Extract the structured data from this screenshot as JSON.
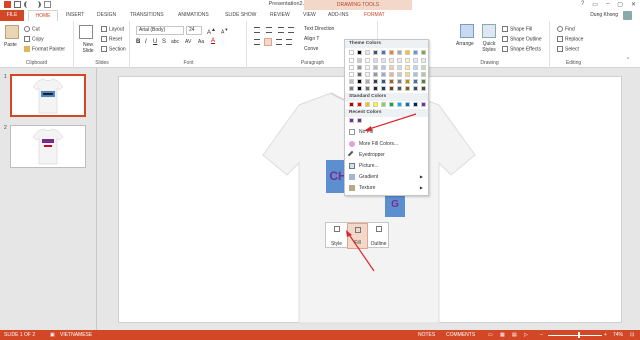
{
  "titlebar": {
    "title": "Presentation2.pptx - Microsoft PowerPoint",
    "contextual_header": "DRAWING TOOLS",
    "window_controls": [
      "?",
      "▭",
      "–",
      "▢",
      "✕"
    ]
  },
  "tabs": [
    "FILE",
    "HOME",
    "INSERT",
    "DESIGN",
    "TRANSITIONS",
    "ANIMATIONS",
    "SLIDE SHOW",
    "REVIEW",
    "VIEW",
    "ADD-INS",
    "FORMAT"
  ],
  "user": {
    "name": "Dung Khong"
  },
  "ribbon": {
    "clipboard": {
      "paste": "Paste",
      "cut": "Cut",
      "copy": "Copy",
      "format_painter": "Format Painter",
      "label": "Clipboard"
    },
    "slides": {
      "new_slide": "New Slide",
      "layout": "Layout",
      "reset": "Reset",
      "section": "Section",
      "label": "Slides"
    },
    "font": {
      "font_name": "Arial (Body)",
      "font_size": "24",
      "bold": "B",
      "italic": "I",
      "underline": "U",
      "strike": "S",
      "shadow": "abc",
      "spacing": "AV",
      "case": "Aa",
      "color": "A",
      "label": "Font"
    },
    "paragraph": {
      "text_direction": "Text Direction",
      "align_text": "Align T",
      "convert": "Conve",
      "label": "Paragraph"
    },
    "drawing": {
      "arrange": "Arrange",
      "quick_styles": "Quick Styles",
      "shape_fill": "Shape Fill",
      "shape_outline": "Shape Outline",
      "shape_effects": "Shape Effects",
      "label": "Drawing"
    },
    "editing": {
      "find": "Find",
      "replace": "Replace",
      "select": "Select",
      "label": "Editing"
    }
  },
  "thumbnails": [
    {
      "num": "1",
      "selected": true
    },
    {
      "num": "2",
      "selected": false
    }
  ],
  "slide": {
    "text_left": "CH",
    "text_right": "G"
  },
  "mini_toolbar": {
    "style": "Style",
    "fill": "Fill",
    "outline": "Outline"
  },
  "fill_dropdown": {
    "theme_colors_label": "Theme Colors",
    "standard_colors_label": "Standard Colors",
    "recent_colors_label": "Recent Colors",
    "no_fill": "No Fill",
    "more_fill_colors": "More Fill Colors...",
    "eyedropper": "Eyedropper",
    "picture": "Picture...",
    "gradient": "Gradient",
    "texture": "Texture",
    "theme_top_row": [
      "#ffffff",
      "#000000",
      "#e7e6e6",
      "#44546a",
      "#4472c4",
      "#ed7d31",
      "#a5a5a5",
      "#ffc000",
      "#5b9bd5",
      "#70ad47"
    ],
    "standard": [
      "#c00000",
      "#ff0000",
      "#ffc000",
      "#ffff00",
      "#92d050",
      "#00b050",
      "#00b0f0",
      "#0070c0",
      "#002060",
      "#7030a0"
    ],
    "recent": [
      "#7030a0",
      "#6b2f8f"
    ]
  },
  "statusbar": {
    "slide_info": "SLIDE 1 OF 2",
    "language": "VIETNAMESE",
    "notes": "NOTES",
    "comments": "COMMENTS",
    "zoom": "74%"
  },
  "colors": {
    "accent": "#d24726",
    "contextual_bg": "#f3d7c8",
    "textbox_blue": "#5b8fcf",
    "arrow_red": "#d9262c"
  }
}
